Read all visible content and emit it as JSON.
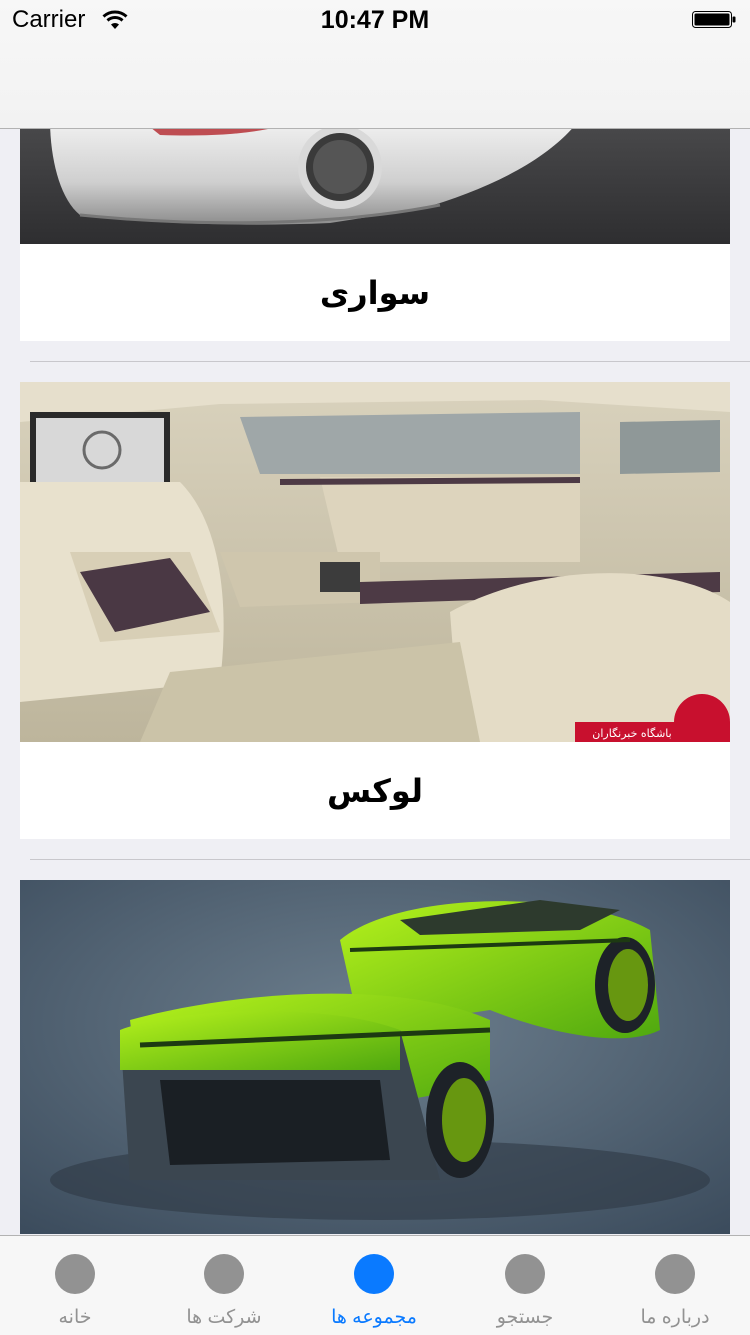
{
  "status_bar": {
    "carrier": "Carrier",
    "time": "10:47 PM"
  },
  "cards": [
    {
      "title": "سواری",
      "image": "silver-sedan-car-photo"
    },
    {
      "title": "لوکس",
      "image": "luxury-car-interior-photo",
      "watermark": "باشگاه خبرنگاران"
    },
    {
      "title": "",
      "image": "green-race-car-photo"
    }
  ],
  "tabbar": {
    "active_index": 2,
    "active_color": "#0a7aff",
    "inactive_color": "#929292",
    "tabs": [
      {
        "label": "خانه"
      },
      {
        "label": "شرکت ها"
      },
      {
        "label": "مجموعه ها"
      },
      {
        "label": "جستجو"
      },
      {
        "label": "درباره  ما"
      }
    ]
  }
}
